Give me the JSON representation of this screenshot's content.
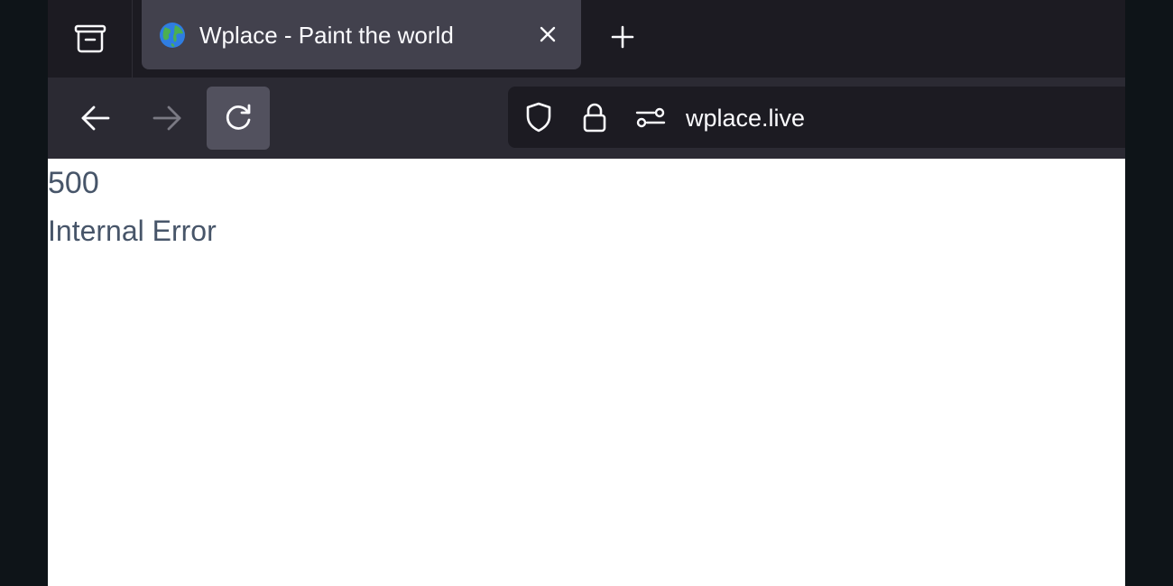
{
  "browser": {
    "tab": {
      "title": "Wplace - Paint the world",
      "favicon": "globe-icon"
    },
    "toolbar": {
      "url": "wplace.live"
    },
    "colors": {
      "tab_strip": "#1c1b22",
      "active_tab": "#42414d",
      "toolbar": "#2b2a33",
      "urlbar": "#1c1b22",
      "text": "#fbfbfe"
    }
  },
  "page": {
    "error_code": "500",
    "error_message": "Internal Error",
    "text_color": "#475569"
  }
}
